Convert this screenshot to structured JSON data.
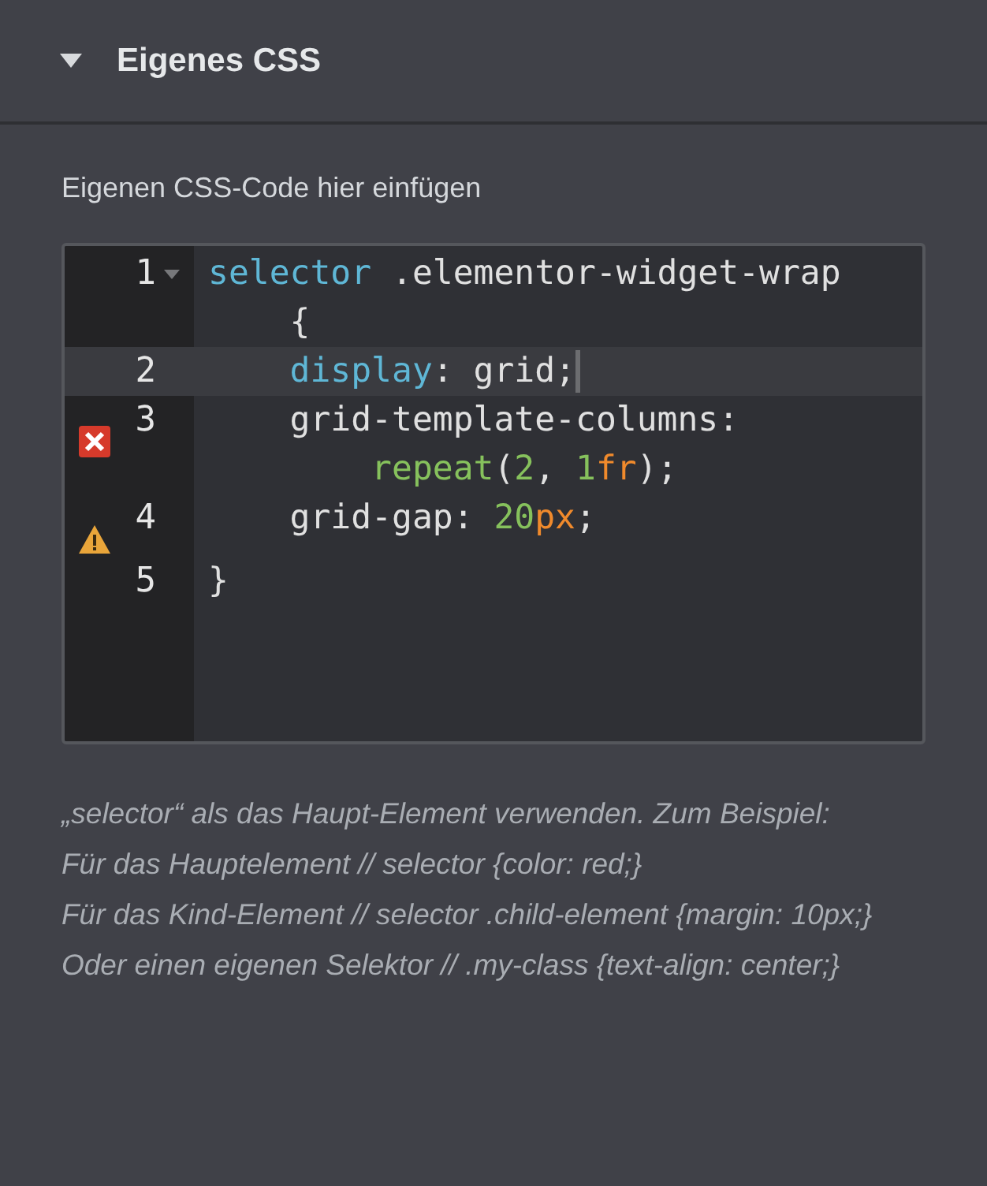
{
  "section": {
    "title": "Eigenes CSS",
    "expanded": true
  },
  "label": "Eigenen CSS-Code hier einfügen",
  "editor": {
    "lines": [
      {
        "number": "1",
        "foldable": true,
        "kind": "plain",
        "active": false,
        "cursor": false,
        "rows": [
          [
            {
              "text": "selector",
              "kind": "keyword"
            },
            {
              "text": " .elementor-widget-wrap",
              "kind": "plain"
            }
          ],
          [
            {
              "text": "    {",
              "kind": "plain"
            }
          ]
        ]
      },
      {
        "number": "2",
        "foldable": false,
        "kind": "plain",
        "active": true,
        "cursor": true,
        "rows": [
          [
            {
              "text": "    display",
              "kind": "keyword"
            },
            {
              "text": ": grid;",
              "kind": "plain"
            }
          ]
        ]
      },
      {
        "number": "3",
        "foldable": false,
        "kind": "error",
        "active": false,
        "cursor": false,
        "rows": [
          [
            {
              "text": "    grid-template-columns:",
              "kind": "plain"
            }
          ],
          [
            {
              "text": "        repeat",
              "kind": "function"
            },
            {
              "text": "(",
              "kind": "plain"
            },
            {
              "text": "2",
              "kind": "number"
            },
            {
              "text": ", ",
              "kind": "plain"
            },
            {
              "text": "1",
              "kind": "number"
            },
            {
              "text": "fr",
              "kind": "unit"
            },
            {
              "text": ");",
              "kind": "plain"
            }
          ]
        ]
      },
      {
        "number": "4",
        "foldable": false,
        "kind": "warning",
        "active": false,
        "cursor": false,
        "rows": [
          [
            {
              "text": "    grid-gap: ",
              "kind": "plain"
            },
            {
              "text": "20",
              "kind": "number"
            },
            {
              "text": "px",
              "kind": "unit"
            },
            {
              "text": ";",
              "kind": "plain"
            }
          ]
        ]
      },
      {
        "number": "5",
        "foldable": false,
        "kind": "plain",
        "active": false,
        "cursor": false,
        "rows": [
          [
            {
              "text": "}",
              "kind": "plain"
            }
          ]
        ]
      }
    ]
  },
  "help": [
    "„selector“ als das Haupt-Element verwenden. Zum Beispiel:",
    "Für das Hauptelement // selector {color: red;}",
    "Für das Kind-Element // selector .child-element {margin: 10px;}",
    "Oder einen eigenen Selektor // .my-class {text-align: center;}"
  ]
}
